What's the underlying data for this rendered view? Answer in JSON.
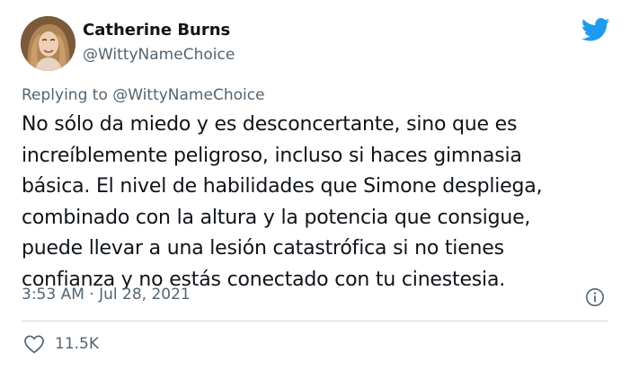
{
  "tweet": {
    "author": {
      "display_name": "Catherine Burns",
      "handle": "@WittyNameChoice",
      "avatar_icon": "profile-photo"
    },
    "brand_icon": "twitter-bird-icon",
    "brand_color": "#1d9bf0",
    "replying_prefix": "Replying to",
    "replying_to": "@WittyNameChoice",
    "body_lines": [
      "No sólo da miedo y es desconcertante, sino que es",
      "increíblemente peligroso, incluso si haces gimnasia",
      "básica. El nivel de habilidades que Simone despliega,",
      "combinado con la altura y la potencia que consigue,",
      "puede llevar a una lesión catastrófica si no tienes",
      "confianza y no estás conectado con tu cinestesia."
    ],
    "timestamp": "3:53 AM · Jul 28, 2021",
    "info_icon": "info-icon",
    "likes_icon": "heart-icon",
    "likes_count": "11.5K"
  }
}
